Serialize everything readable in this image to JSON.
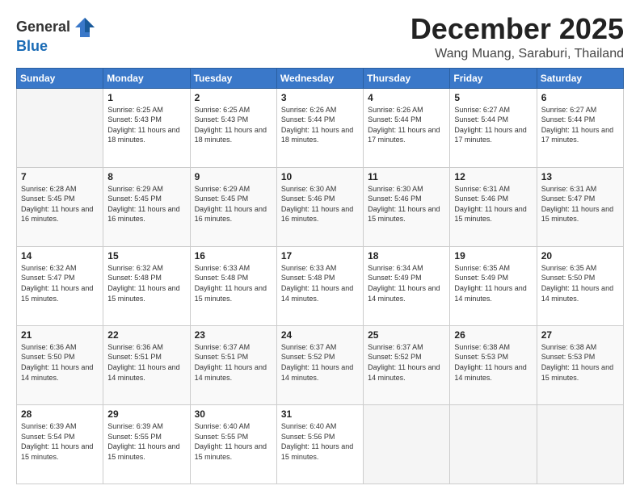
{
  "header": {
    "logo_general": "General",
    "logo_blue": "Blue",
    "title": "December 2025",
    "subtitle": "Wang Muang, Saraburi, Thailand"
  },
  "days_of_week": [
    "Sunday",
    "Monday",
    "Tuesday",
    "Wednesday",
    "Thursday",
    "Friday",
    "Saturday"
  ],
  "weeks": [
    [
      {
        "day": "",
        "sunrise": "",
        "sunset": "",
        "daylight": ""
      },
      {
        "day": "1",
        "sunrise": "Sunrise: 6:25 AM",
        "sunset": "Sunset: 5:43 PM",
        "daylight": "Daylight: 11 hours and 18 minutes."
      },
      {
        "day": "2",
        "sunrise": "Sunrise: 6:25 AM",
        "sunset": "Sunset: 5:43 PM",
        "daylight": "Daylight: 11 hours and 18 minutes."
      },
      {
        "day": "3",
        "sunrise": "Sunrise: 6:26 AM",
        "sunset": "Sunset: 5:44 PM",
        "daylight": "Daylight: 11 hours and 18 minutes."
      },
      {
        "day": "4",
        "sunrise": "Sunrise: 6:26 AM",
        "sunset": "Sunset: 5:44 PM",
        "daylight": "Daylight: 11 hours and 17 minutes."
      },
      {
        "day": "5",
        "sunrise": "Sunrise: 6:27 AM",
        "sunset": "Sunset: 5:44 PM",
        "daylight": "Daylight: 11 hours and 17 minutes."
      },
      {
        "day": "6",
        "sunrise": "Sunrise: 6:27 AM",
        "sunset": "Sunset: 5:44 PM",
        "daylight": "Daylight: 11 hours and 17 minutes."
      }
    ],
    [
      {
        "day": "7",
        "sunrise": "Sunrise: 6:28 AM",
        "sunset": "Sunset: 5:45 PM",
        "daylight": "Daylight: 11 hours and 16 minutes."
      },
      {
        "day": "8",
        "sunrise": "Sunrise: 6:29 AM",
        "sunset": "Sunset: 5:45 PM",
        "daylight": "Daylight: 11 hours and 16 minutes."
      },
      {
        "day": "9",
        "sunrise": "Sunrise: 6:29 AM",
        "sunset": "Sunset: 5:45 PM",
        "daylight": "Daylight: 11 hours and 16 minutes."
      },
      {
        "day": "10",
        "sunrise": "Sunrise: 6:30 AM",
        "sunset": "Sunset: 5:46 PM",
        "daylight": "Daylight: 11 hours and 16 minutes."
      },
      {
        "day": "11",
        "sunrise": "Sunrise: 6:30 AM",
        "sunset": "Sunset: 5:46 PM",
        "daylight": "Daylight: 11 hours and 15 minutes."
      },
      {
        "day": "12",
        "sunrise": "Sunrise: 6:31 AM",
        "sunset": "Sunset: 5:46 PM",
        "daylight": "Daylight: 11 hours and 15 minutes."
      },
      {
        "day": "13",
        "sunrise": "Sunrise: 6:31 AM",
        "sunset": "Sunset: 5:47 PM",
        "daylight": "Daylight: 11 hours and 15 minutes."
      }
    ],
    [
      {
        "day": "14",
        "sunrise": "Sunrise: 6:32 AM",
        "sunset": "Sunset: 5:47 PM",
        "daylight": "Daylight: 11 hours and 15 minutes."
      },
      {
        "day": "15",
        "sunrise": "Sunrise: 6:32 AM",
        "sunset": "Sunset: 5:48 PM",
        "daylight": "Daylight: 11 hours and 15 minutes."
      },
      {
        "day": "16",
        "sunrise": "Sunrise: 6:33 AM",
        "sunset": "Sunset: 5:48 PM",
        "daylight": "Daylight: 11 hours and 15 minutes."
      },
      {
        "day": "17",
        "sunrise": "Sunrise: 6:33 AM",
        "sunset": "Sunset: 5:48 PM",
        "daylight": "Daylight: 11 hours and 14 minutes."
      },
      {
        "day": "18",
        "sunrise": "Sunrise: 6:34 AM",
        "sunset": "Sunset: 5:49 PM",
        "daylight": "Daylight: 11 hours and 14 minutes."
      },
      {
        "day": "19",
        "sunrise": "Sunrise: 6:35 AM",
        "sunset": "Sunset: 5:49 PM",
        "daylight": "Daylight: 11 hours and 14 minutes."
      },
      {
        "day": "20",
        "sunrise": "Sunrise: 6:35 AM",
        "sunset": "Sunset: 5:50 PM",
        "daylight": "Daylight: 11 hours and 14 minutes."
      }
    ],
    [
      {
        "day": "21",
        "sunrise": "Sunrise: 6:36 AM",
        "sunset": "Sunset: 5:50 PM",
        "daylight": "Daylight: 11 hours and 14 minutes."
      },
      {
        "day": "22",
        "sunrise": "Sunrise: 6:36 AM",
        "sunset": "Sunset: 5:51 PM",
        "daylight": "Daylight: 11 hours and 14 minutes."
      },
      {
        "day": "23",
        "sunrise": "Sunrise: 6:37 AM",
        "sunset": "Sunset: 5:51 PM",
        "daylight": "Daylight: 11 hours and 14 minutes."
      },
      {
        "day": "24",
        "sunrise": "Sunrise: 6:37 AM",
        "sunset": "Sunset: 5:52 PM",
        "daylight": "Daylight: 11 hours and 14 minutes."
      },
      {
        "day": "25",
        "sunrise": "Sunrise: 6:37 AM",
        "sunset": "Sunset: 5:52 PM",
        "daylight": "Daylight: 11 hours and 14 minutes."
      },
      {
        "day": "26",
        "sunrise": "Sunrise: 6:38 AM",
        "sunset": "Sunset: 5:53 PM",
        "daylight": "Daylight: 11 hours and 14 minutes."
      },
      {
        "day": "27",
        "sunrise": "Sunrise: 6:38 AM",
        "sunset": "Sunset: 5:53 PM",
        "daylight": "Daylight: 11 hours and 15 minutes."
      }
    ],
    [
      {
        "day": "28",
        "sunrise": "Sunrise: 6:39 AM",
        "sunset": "Sunset: 5:54 PM",
        "daylight": "Daylight: 11 hours and 15 minutes."
      },
      {
        "day": "29",
        "sunrise": "Sunrise: 6:39 AM",
        "sunset": "Sunset: 5:55 PM",
        "daylight": "Daylight: 11 hours and 15 minutes."
      },
      {
        "day": "30",
        "sunrise": "Sunrise: 6:40 AM",
        "sunset": "Sunset: 5:55 PM",
        "daylight": "Daylight: 11 hours and 15 minutes."
      },
      {
        "day": "31",
        "sunrise": "Sunrise: 6:40 AM",
        "sunset": "Sunset: 5:56 PM",
        "daylight": "Daylight: 11 hours and 15 minutes."
      },
      {
        "day": "",
        "sunrise": "",
        "sunset": "",
        "daylight": ""
      },
      {
        "day": "",
        "sunrise": "",
        "sunset": "",
        "daylight": ""
      },
      {
        "day": "",
        "sunrise": "",
        "sunset": "",
        "daylight": ""
      }
    ]
  ]
}
